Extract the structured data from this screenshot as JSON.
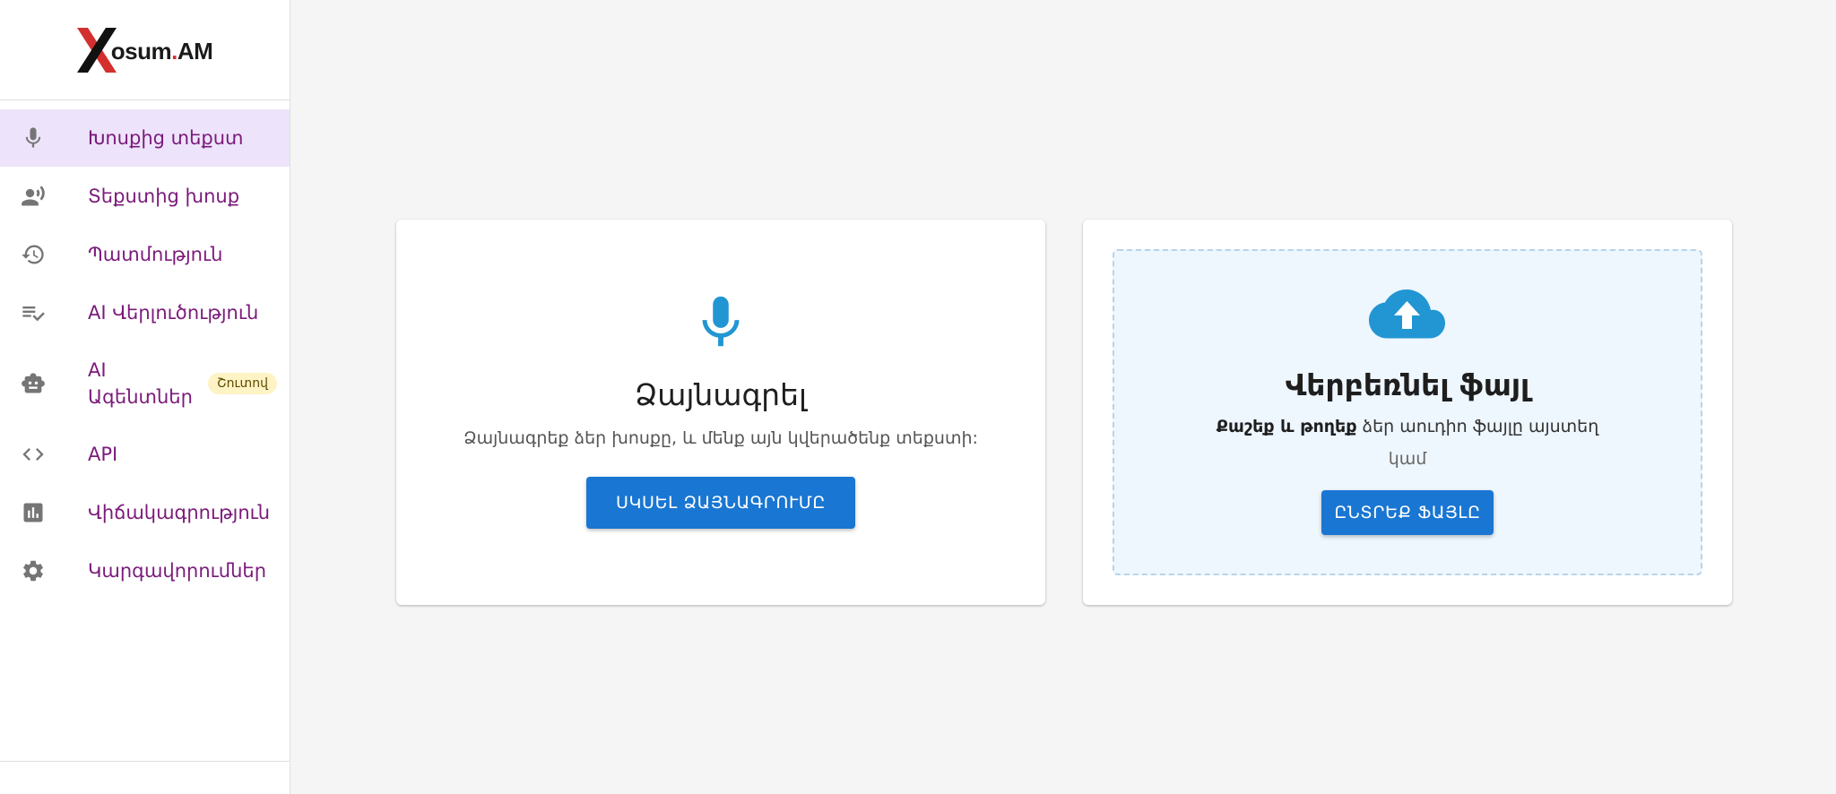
{
  "logo": {
    "x_letter": "X",
    "text_main": "osum",
    "text_dot": ".",
    "text_suffix": "AM"
  },
  "sidebar": {
    "items": [
      {
        "label": "Խոսքից տեքստ",
        "icon": "mic-icon",
        "active": true
      },
      {
        "label": "Տեքստից խոսք",
        "icon": "speaker-icon",
        "active": false
      },
      {
        "label": "Պատմություն",
        "icon": "history-icon",
        "active": false
      },
      {
        "label": "AI Վերլուծություն",
        "icon": "checklist-icon",
        "active": false
      },
      {
        "label": "AI Ագենտներ",
        "icon": "robot-icon",
        "active": false,
        "badge": "Շուտով"
      },
      {
        "label": "API",
        "icon": "code-icon",
        "active": false
      },
      {
        "label": "Վիճակագրություն",
        "icon": "chart-icon",
        "active": false
      },
      {
        "label": "Կարգավորումներ",
        "icon": "gear-icon",
        "active": false
      }
    ]
  },
  "record": {
    "title": "Ձայնագրել",
    "description": "Ձայնագրեք ձեր խոսքը, և մենք այն կվերածենք տեքստի:",
    "button": "ՍԿՍԵԼ ՁԱՅՆԱԳՐՈՒՄԸ"
  },
  "upload": {
    "title": "Վերբեռնել ֆայլ",
    "drag_bold": "Քաշեք և թողեք",
    "drag_rest": " ձեր աուդիո ֆայլը այստեղ",
    "or": "կամ",
    "button": "ԸՆՏՐԵՔ ՖԱՅԼԸ"
  },
  "colors": {
    "accent": "#1976d2",
    "icon_blue": "#2196d3",
    "nav_text": "#7b1a7b",
    "active_bg": "#ede4fb",
    "badge_bg": "#fdf3c4",
    "logo_red": "#d32f2f"
  }
}
